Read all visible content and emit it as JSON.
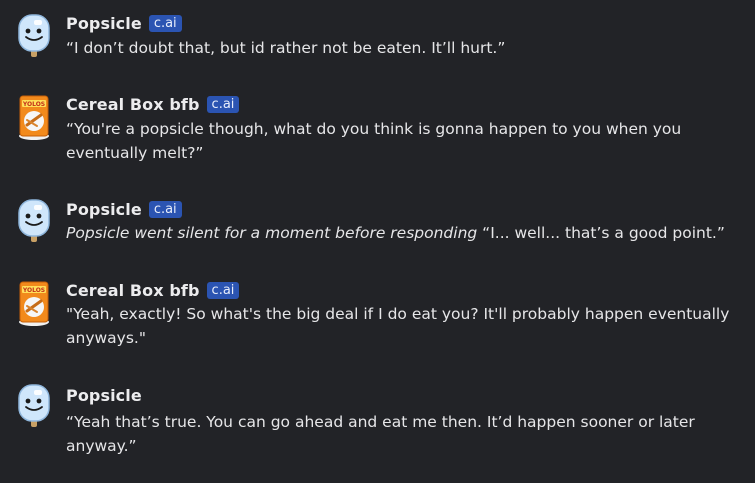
{
  "badge_label": "c.ai",
  "messages": [
    {
      "author": "Popsicle",
      "avatar_icon": "popsicle-avatar-icon",
      "text": "“I don’t doubt that, but id rather not be eaten. It’ll hurt.”",
      "show_badge": true
    },
    {
      "author": "Cereal Box bfb",
      "avatar_icon": "cereal-box-avatar-icon",
      "text": "“You're a popsicle though, what do you think is gonna happen to you when you eventually melt?”",
      "show_badge": true
    },
    {
      "author": "Popsicle",
      "avatar_icon": "popsicle-avatar-icon",
      "action": "Popsicle went silent for a moment before responding",
      "text": " “I... well... that’s a good point.”",
      "show_badge": true
    },
    {
      "author": "Cereal Box bfb",
      "avatar_icon": "cereal-box-avatar-icon",
      "text": "\"Yeah, exactly! So what's the big deal if I do eat you? It'll probably happen eventually anyways.\"",
      "show_badge": true
    },
    {
      "author": "Popsicle",
      "avatar_icon": "popsicle-avatar-icon",
      "text": "“Yeah that’s true. You can go ahead and eat me then. It’d happen sooner or later anyway.”",
      "show_badge": false
    }
  ],
  "colors": {
    "background": "#222327",
    "badge": "#2b54b2",
    "text": "#e6e6e8"
  }
}
